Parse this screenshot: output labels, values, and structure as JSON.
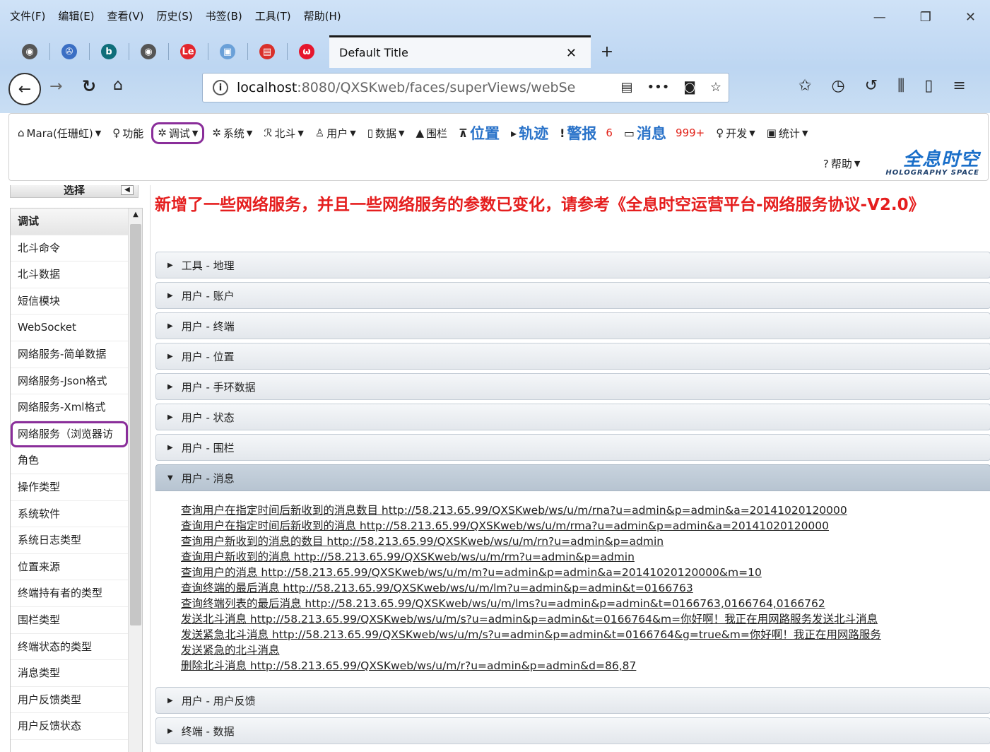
{
  "browser": {
    "menu": [
      "文件(F)",
      "编辑(E)",
      "查看(V)",
      "历史(S)",
      "书签(B)",
      "工具(T)",
      "帮助(H)"
    ],
    "tab_title": "Default Title",
    "url_host": "localhost",
    "url_rest": ":8080/QXSKweb/faces/superViews/webSe",
    "pinned": [
      {
        "icon": "globe-icon",
        "glyph": "◉",
        "color": "#555"
      },
      {
        "icon": "puzzle-icon",
        "glyph": "✇",
        "color": "#3b6fc4"
      },
      {
        "icon": "bing-icon",
        "glyph": "b",
        "color": "#0f6e7a"
      },
      {
        "icon": "globe-icon",
        "glyph": "◉",
        "color": "#555"
      },
      {
        "icon": "le-icon",
        "glyph": "Le",
        "color": "#e3262d"
      },
      {
        "icon": "image-icon",
        "glyph": "▣",
        "color": "#6aa0d8"
      },
      {
        "icon": "radio-icon",
        "glyph": "▤",
        "color": "#d9302b"
      },
      {
        "icon": "weibo-icon",
        "glyph": "ω",
        "color": "#e6162d"
      }
    ]
  },
  "nav": {
    "user": "Mara(任珊虹)",
    "features": "功能",
    "debug": "调试",
    "system": "系统",
    "beidou": "北斗",
    "users": "用户",
    "data": "数据",
    "fence": "围栏",
    "position": "位置",
    "track": "轨迹",
    "alarm": "警报",
    "alarm_count": "6",
    "message": "消息",
    "message_count": "999+",
    "dev": "开发",
    "stats": "统计",
    "help": "帮助",
    "logo_cn": "全息时空",
    "logo_en": "HOLOGRAPHY SPACE"
  },
  "sidebar": {
    "title": "选择",
    "items": [
      "调试",
      "北斗命令",
      "北斗数据",
      "短信模块",
      "WebSocket",
      "网络服务-简单数据",
      "网络服务-Json格式",
      "网络服务-Xml格式",
      "网络服务（浏览器访",
      "角色",
      "操作类型",
      "系统软件",
      "系统日志类型",
      "位置来源",
      "终端持有者的类型",
      "围栏类型",
      "终端状态的类型",
      "消息类型",
      "用户反馈类型",
      "用户反馈状态"
    ]
  },
  "main": {
    "notice": "新增了一些网络服务，并且一些网络服务的参数已变化，请参考《全息时空运营平台-网络服务协议-V2.0》",
    "sections": [
      "工具 - 地理",
      "用户 - 账户",
      "用户 - 终端",
      "用户 - 位置",
      "用户 - 手环数据",
      "用户 - 状态",
      "用户 - 围栏"
    ],
    "open_section": "用户 - 消息",
    "links": [
      "查询用户在指定时间后新收到的消息数目 http://58.213.65.99/QXSKweb/ws/u/m/rna?u=admin&p=admin&a=20141020120000",
      "查询用户在指定时间后新收到的消息 http://58.213.65.99/QXSKweb/ws/u/m/rma?u=admin&p=admin&a=20141020120000",
      "查询用户新收到的消息的数目 http://58.213.65.99/QXSKweb/ws/u/m/rn?u=admin&p=admin",
      "查询用户新收到的消息 http://58.213.65.99/QXSKweb/ws/u/m/rm?u=admin&p=admin",
      "查询用户的消息 http://58.213.65.99/QXSKweb/ws/u/m/m?u=admin&p=admin&a=20141020120000&m=10",
      "查询终端的最后消息 http://58.213.65.99/QXSKweb/ws/u/m/lm?u=admin&p=admin&t=0166763",
      "查询终端列表的最后消息 http://58.213.65.99/QXSKweb/ws/u/m/lms?u=admin&p=admin&t=0166763,0166764,0166762",
      "发送北斗消息 http://58.213.65.99/QXSKweb/ws/u/m/s?u=admin&p=admin&t=0166764&m=你好啊！我正在用网路服务发送北斗消息",
      "发送紧急北斗消息 http://58.213.65.99/QXSKweb/ws/u/m/s?u=admin&p=admin&t=0166764&g=true&m=你好啊！我正在用网路服务",
      "发送紧急的北斗消息",
      "删除北斗消息 http://58.213.65.99/QXSKweb/ws/u/m/r?u=admin&p=admin&d=86,87"
    ],
    "after_sections": [
      "用户 - 用户反馈",
      "终端 - 数据"
    ]
  }
}
